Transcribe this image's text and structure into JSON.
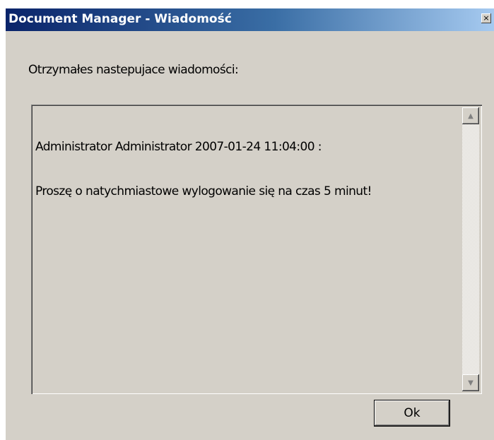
{
  "window": {
    "title": "Document Manager - Wiadomość",
    "close_glyph": "×"
  },
  "prompt": "Otrzymałes nastepujace wiadomości:",
  "message": {
    "line1": "Administrator Administrator 2007-01-24 11:04:00 :",
    "line2": "Proszę o natychmiastowe wylogowanie się na czas 5 minut!"
  },
  "scrollbar": {
    "up_glyph": "▲",
    "down_glyph": "▼"
  },
  "buttons": {
    "ok_label": "Ok"
  },
  "colors": {
    "title_gradient_start": "#0a246a",
    "title_gradient_end": "#a6caf0",
    "face": "#d4d0c8"
  }
}
